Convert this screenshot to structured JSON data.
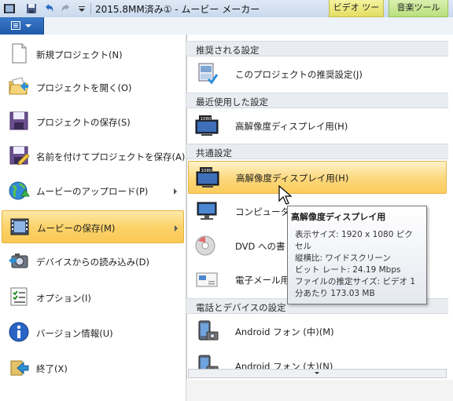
{
  "titlebar": {
    "title": "2015.8MM済み① - ムービー メーカー",
    "context_tabs": [
      {
        "label": "ビデオ ツール",
        "color": "#eae57a"
      },
      {
        "label": "音楽ツール",
        "color": "#c6e694"
      }
    ]
  },
  "left_menu": {
    "items": [
      {
        "label": "新規プロジェクト(N)",
        "icon": "new-project-icon"
      },
      {
        "label": "プロジェクトを開く(O)",
        "icon": "open-folder-icon"
      },
      {
        "label": "プロジェクトの保存(S)",
        "icon": "save-disk-icon"
      },
      {
        "label": "名前を付けてプロジェクトを保存(A)",
        "icon": "save-as-icon"
      },
      {
        "label": "ムービーのアップロード(P)",
        "icon": "globe-upload-icon",
        "submenu": true
      },
      {
        "label": "ムービーの保存(M)",
        "icon": "film-save-icon",
        "submenu": true,
        "selected": true
      },
      {
        "label": "デバイスからの読み込み(D)",
        "icon": "camera-import-icon"
      },
      {
        "label": "オプション(I)",
        "icon": "options-list-icon"
      },
      {
        "label": "バージョン情報(U)",
        "icon": "info-icon"
      },
      {
        "label": "終了(X)",
        "icon": "exit-icon"
      }
    ]
  },
  "right_panel": {
    "sections": [
      {
        "header": "推奨される設定",
        "items": [
          {
            "label": "このプロジェクトの推奨設定(J)",
            "icon": "recommended-settings-icon"
          }
        ]
      },
      {
        "header": "最近使用した設定",
        "items": [
          {
            "label": "高解像度ディスプレイ用(H)",
            "icon": "hd-display-1080-icon"
          }
        ]
      },
      {
        "header": "共通設定",
        "items": [
          {
            "label": "高解像度ディスプレイ用(H)",
            "icon": "hd-display-1080-icon",
            "selected": true
          },
          {
            "label": "コンピューター",
            "icon": "computer-monitor-icon"
          },
          {
            "label": "DVD への書",
            "icon": "dvd-icon"
          },
          {
            "label": "電子メール用",
            "icon": "email-icon"
          }
        ]
      },
      {
        "header": "電話とデバイスの設定",
        "items": [
          {
            "label": "Android フォン (中)(M)",
            "icon": "android-phone-icon"
          },
          {
            "label": "Android フォン (大)(N)",
            "icon": "android-phone-icon"
          }
        ]
      }
    ]
  },
  "tooltip": {
    "title": "高解像度ディスプレイ用",
    "lines": [
      "表示サイズ: 1920 x 1080 ピク",
      "セル",
      "縦横比: ワイドスクリーン",
      "ビット レート: 24.19 Mbps",
      "ファイルの推定サイズ: ビデオ 1",
      "分あたり 173.03 MB"
    ]
  },
  "colors": {
    "selected_item": "#fbd36a",
    "file_button": "#2a66b8",
    "section_header": "#e9ecf0"
  }
}
